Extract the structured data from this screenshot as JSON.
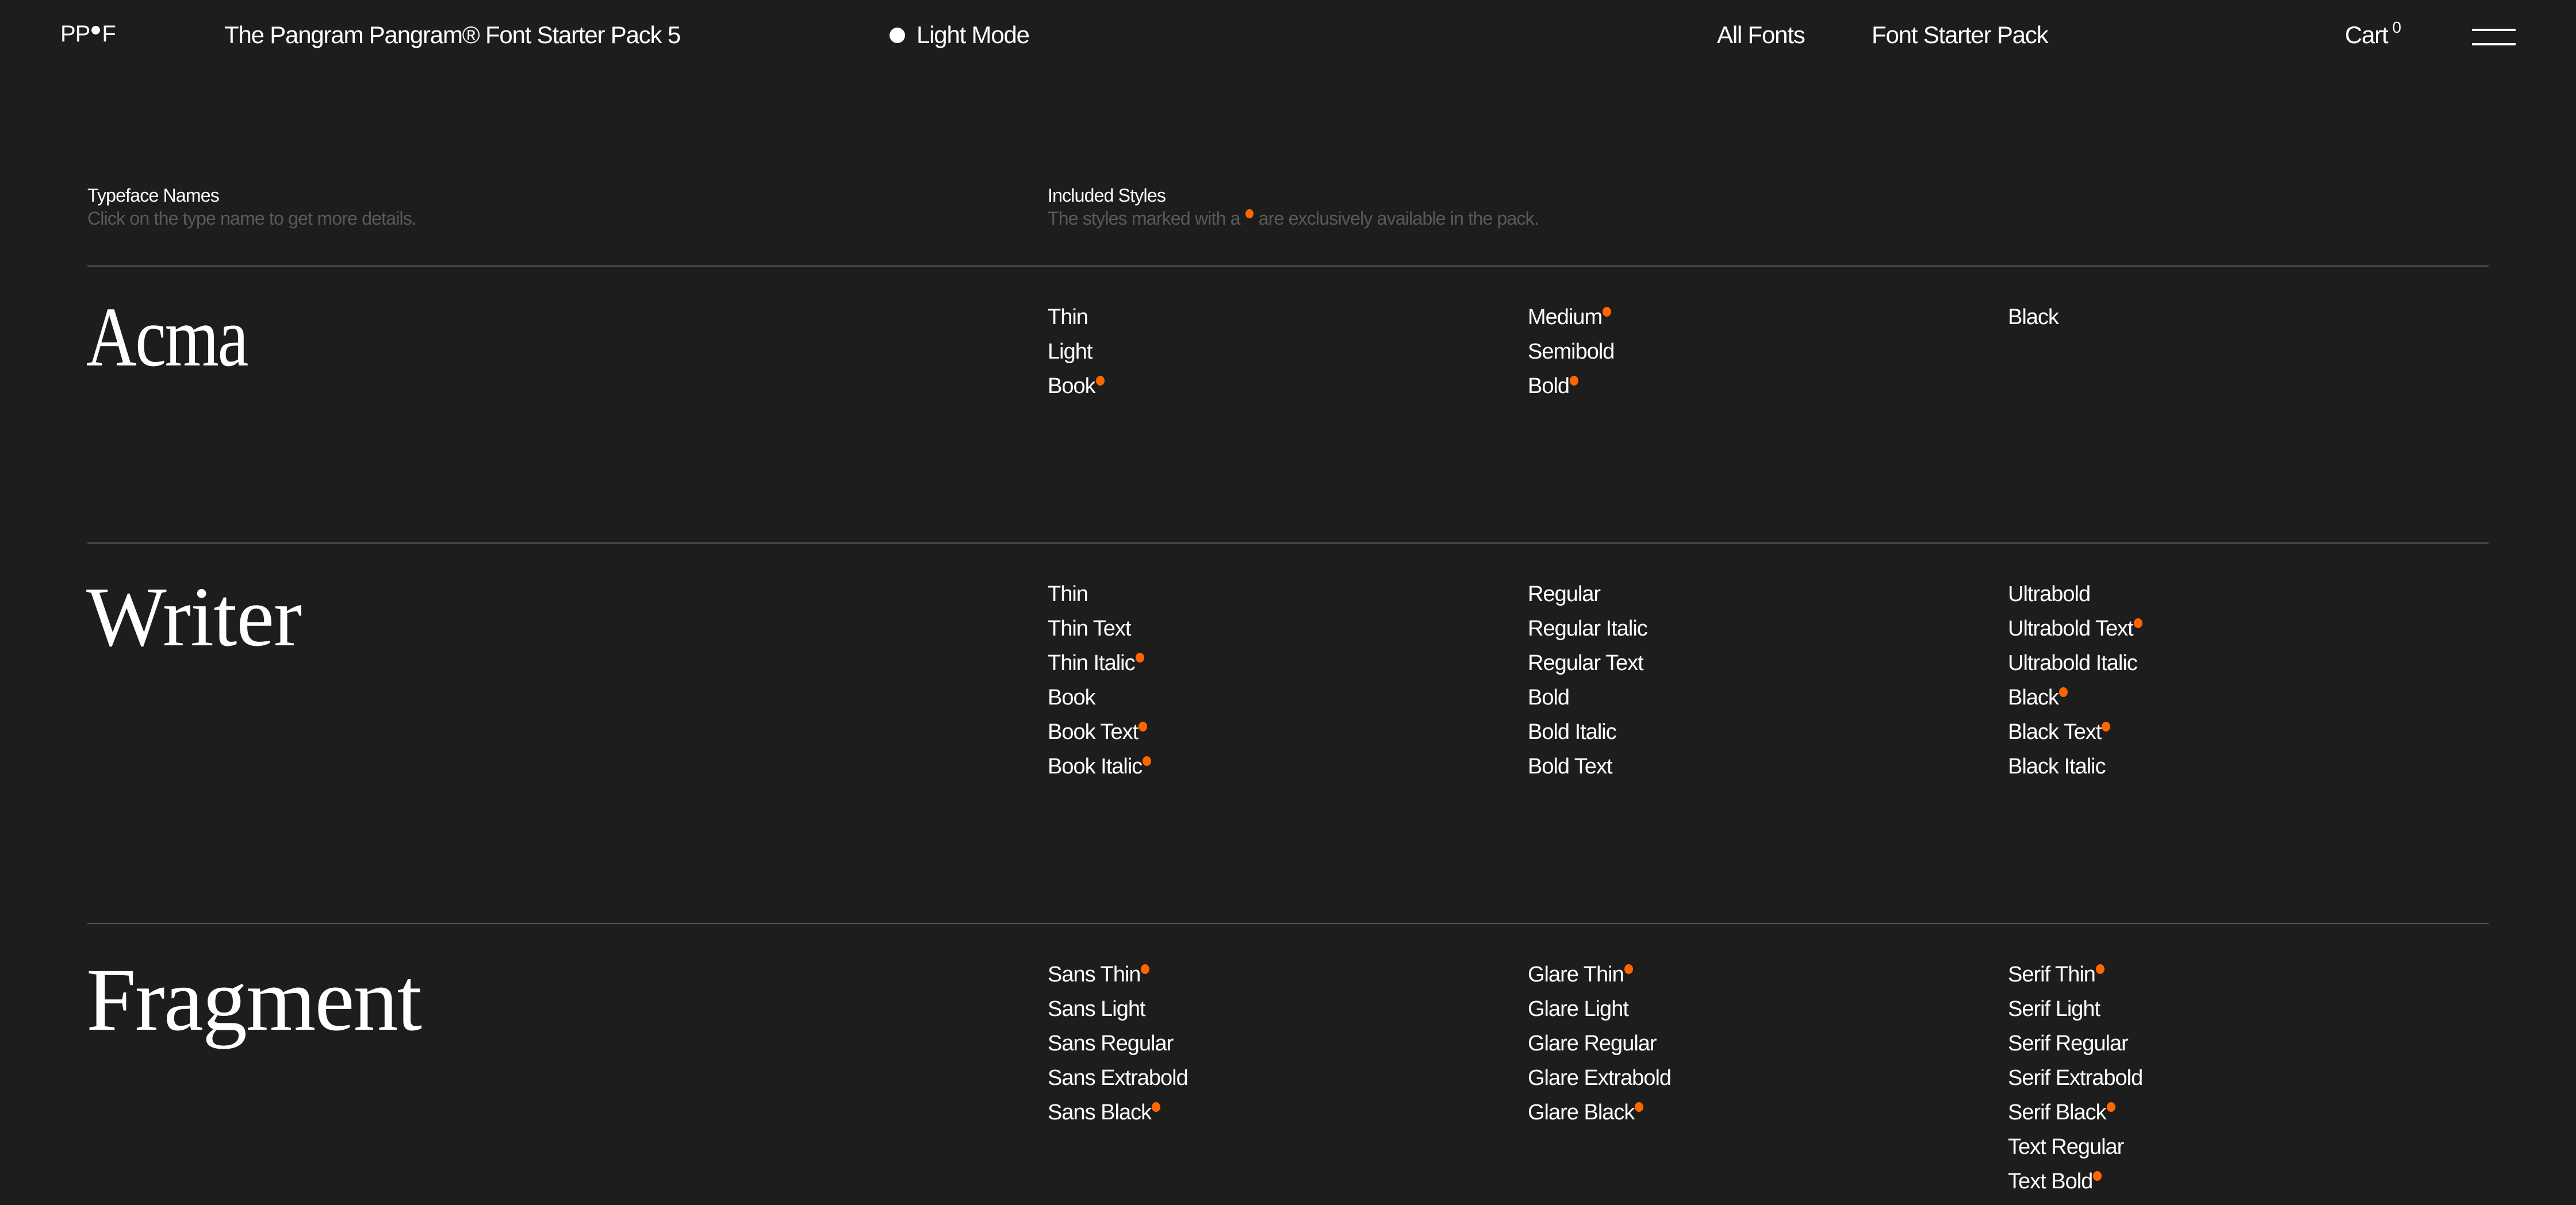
{
  "header": {
    "logo_left": "PP",
    "logo_right": "F",
    "title": "The Pangram Pangram® Font Starter Pack 5",
    "mode_toggle": "Light Mode",
    "nav": [
      "All Fonts",
      "Font Starter Pack"
    ],
    "cart_label": "Cart",
    "cart_count": "0"
  },
  "columns": {
    "names_title": "Typeface Names",
    "names_subtitle": "Click on the type name to get more details.",
    "styles_title": "Included Styles",
    "styles_subtitle_before": "The styles marked with a",
    "styles_subtitle_after": "are exclusively available in the pack."
  },
  "accent_color": "#ff6600",
  "families": [
    {
      "name": "Acma",
      "columns": [
        [
          {
            "label": "Thin",
            "exclusive": false
          },
          {
            "label": "Light",
            "exclusive": false
          },
          {
            "label": "Book",
            "exclusive": true
          }
        ],
        [
          {
            "label": "Medium",
            "exclusive": true
          },
          {
            "label": "Semibold",
            "exclusive": false
          },
          {
            "label": "Bold",
            "exclusive": true
          }
        ],
        [
          {
            "label": "Black",
            "exclusive": false
          }
        ]
      ]
    },
    {
      "name": "Writer",
      "columns": [
        [
          {
            "label": "Thin",
            "exclusive": false
          },
          {
            "label": "Thin Text",
            "exclusive": false
          },
          {
            "label": "Thin Italic",
            "exclusive": true
          },
          {
            "label": "Book",
            "exclusive": false
          },
          {
            "label": "Book Text",
            "exclusive": true
          },
          {
            "label": "Book Italic",
            "exclusive": true
          }
        ],
        [
          {
            "label": "Regular",
            "exclusive": false
          },
          {
            "label": "Regular Italic",
            "exclusive": false
          },
          {
            "label": "Regular Text",
            "exclusive": false
          },
          {
            "label": "Bold",
            "exclusive": false
          },
          {
            "label": "Bold Italic",
            "exclusive": false
          },
          {
            "label": "Bold Text",
            "exclusive": false
          }
        ],
        [
          {
            "label": "Ultrabold",
            "exclusive": false
          },
          {
            "label": "Ultrabold Text",
            "exclusive": true
          },
          {
            "label": "Ultrabold Italic",
            "exclusive": false
          },
          {
            "label": "Black",
            "exclusive": true
          },
          {
            "label": "Black Text",
            "exclusive": true
          },
          {
            "label": "Black Italic",
            "exclusive": false
          }
        ]
      ]
    },
    {
      "name": "Fragment",
      "columns": [
        [
          {
            "label": "Sans Thin",
            "exclusive": true
          },
          {
            "label": "Sans Light",
            "exclusive": false
          },
          {
            "label": "Sans Regular",
            "exclusive": false
          },
          {
            "label": "Sans Extrabold",
            "exclusive": false
          },
          {
            "label": "Sans Black",
            "exclusive": true
          }
        ],
        [
          {
            "label": "Glare Thin",
            "exclusive": true
          },
          {
            "label": "Glare Light",
            "exclusive": false
          },
          {
            "label": "Glare Regular",
            "exclusive": false
          },
          {
            "label": "Glare Extrabold",
            "exclusive": false
          },
          {
            "label": "Glare Black",
            "exclusive": true
          }
        ],
        [
          {
            "label": "Serif Thin",
            "exclusive": true
          },
          {
            "label": "Serif Light",
            "exclusive": false
          },
          {
            "label": "Serif Regular",
            "exclusive": false
          },
          {
            "label": "Serif Extrabold",
            "exclusive": false
          },
          {
            "label": "Serif Black",
            "exclusive": true
          },
          {
            "label": "Text Regular",
            "exclusive": false
          },
          {
            "label": "Text Bold",
            "exclusive": true
          }
        ]
      ]
    }
  ]
}
